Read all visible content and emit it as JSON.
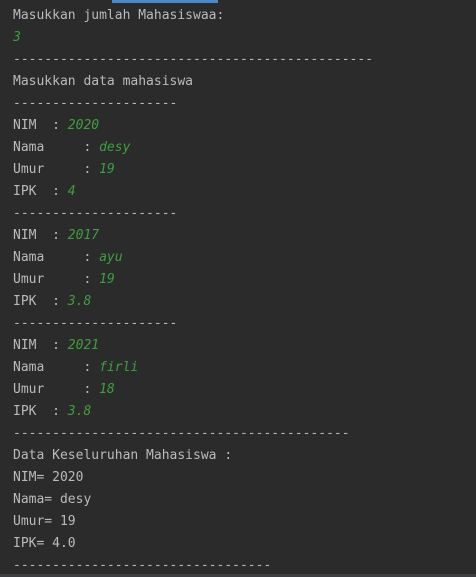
{
  "colors": {
    "background": "#2b2b2b",
    "text": "#bbbbbb",
    "input": "#3f9f3f",
    "accent": "#4a88c7"
  },
  "console": {
    "lines": [
      {
        "label": "Masukkan jumlah Mahasiswaa:",
        "value": ""
      },
      {
        "label": "",
        "value": "3"
      },
      {
        "label": "----------------------------------------------",
        "value": ""
      },
      {
        "label": "Masukkan data mahasiswa",
        "value": ""
      },
      {
        "label": "---------------------",
        "value": ""
      },
      {
        "label": "NIM  : ",
        "value": "2020"
      },
      {
        "label": "Nama     : ",
        "value": "desy"
      },
      {
        "label": "Umur     : ",
        "value": "19"
      },
      {
        "label": "IPK  : ",
        "value": "4"
      },
      {
        "label": "---------------------",
        "value": ""
      },
      {
        "label": "NIM  : ",
        "value": "2017"
      },
      {
        "label": "Nama     : ",
        "value": "ayu"
      },
      {
        "label": "Umur     : ",
        "value": "19"
      },
      {
        "label": "IPK  : ",
        "value": "3.8"
      },
      {
        "label": "---------------------",
        "value": ""
      },
      {
        "label": "NIM  : ",
        "value": "2021"
      },
      {
        "label": "Nama     : ",
        "value": "firli"
      },
      {
        "label": "Umur     : ",
        "value": "18"
      },
      {
        "label": "IPK  : ",
        "value": "3.8"
      },
      {
        "label": "-------------------------------------------",
        "value": ""
      },
      {
        "label": "Data Keseluruhan Mahasiswa :",
        "value": ""
      },
      {
        "label": "NIM= 2020",
        "value": ""
      },
      {
        "label": "Nama= desy",
        "value": ""
      },
      {
        "label": "Umur= 19",
        "value": ""
      },
      {
        "label": "IPK= 4.0",
        "value": ""
      },
      {
        "label": "---------------------------------",
        "value": ""
      }
    ]
  }
}
